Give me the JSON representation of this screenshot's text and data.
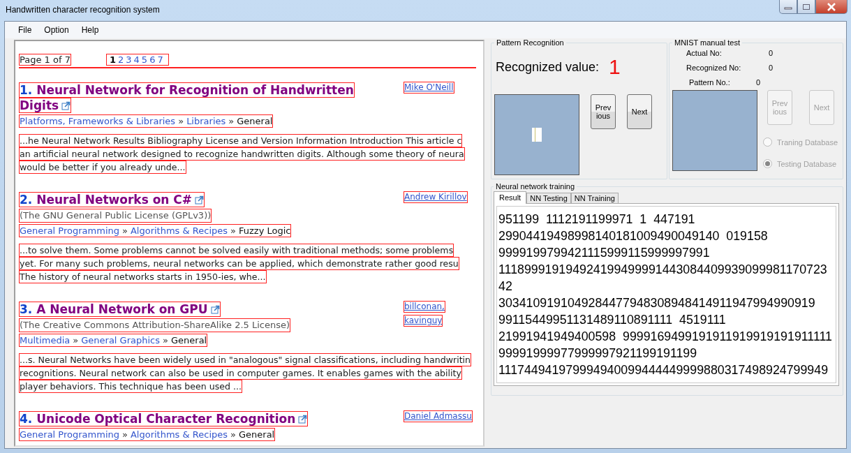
{
  "window": {
    "title": "Handwritten character recognition system"
  },
  "menu": [
    "File",
    "Option",
    "Help"
  ],
  "browser": {
    "page_label": "Page 1 of 7",
    "pages": [
      {
        "label": "1",
        "selected": true
      },
      {
        "label": "2",
        "selected": false
      },
      {
        "label": "3",
        "selected": false
      },
      {
        "label": "4",
        "selected": false
      },
      {
        "label": "5",
        "selected": false
      },
      {
        "label": "6",
        "selected": false
      },
      {
        "label": "7",
        "selected": false
      }
    ],
    "articles": [
      {
        "number": "1.",
        "title_lines": [
          "Neural Network for Recognition of Handwritten",
          "Digits"
        ],
        "authors": [
          "Mike O'Neill"
        ],
        "breadcrumb": {
          "links": [
            "Platforms, Frameworks & Libraries",
            "Libraries"
          ],
          "separator": "»",
          "current": "General"
        },
        "excerpt": [
          "...he Neural Network Results Bibliography License and Version Information Introduction This article c",
          "an artificial neural network designed to recognize handwritten digits. Although some theory of neura",
          "would be better if you already unde..."
        ]
      },
      {
        "number": "2.",
        "title_lines": [
          "Neural Networks on C#"
        ],
        "authors": [
          "Andrew Kirillov"
        ],
        "license": "(The GNU General Public License (GPLv3))",
        "breadcrumb": {
          "links": [
            "General Programming",
            "Algorithms & Recipes"
          ],
          "separator": "»",
          "current": "Fuzzy Logic"
        },
        "excerpt": [
          "...to solve them. Some problems cannot be solved easily with traditional methods; some problems",
          "yet. For many such problems, neural networks can be applied, which demonstrate rather good resu",
          "The history of neural networks starts in 1950-ies, whe..."
        ]
      },
      {
        "number": "3.",
        "title_lines": [
          "A Neural Network on GPU"
        ],
        "authors": [
          "billconan,",
          "kavinguy"
        ],
        "license": "(The Creative Commons Attribution-ShareAlike 2.5 License)",
        "breadcrumb": {
          "links": [
            "Multimedia",
            "General Graphics"
          ],
          "separator": "»",
          "current": "General"
        },
        "excerpt": [
          "...s. Neural Networks have been widely used in \"analogous\" signal classifications, including handwritin",
          "recognitions. Neural network can also be used in computer games. It enables games with the ability",
          "player behaviors. This technique has been used ..."
        ]
      },
      {
        "number": "4.",
        "title_lines": [
          "Unicode Optical Character Recognition"
        ],
        "authors": [
          "Daniel Admassu"
        ],
        "breadcrumb": {
          "links": [
            "General Programming",
            "Algorithms & Recipes"
          ],
          "separator": "»",
          "current": "General"
        }
      }
    ]
  },
  "pattern_recognition": {
    "title": "Pattern Recognition",
    "label": "Recognized value:",
    "value": "1",
    "buttons": [
      {
        "lines": [
          "Prev",
          "ious"
        ],
        "disabled": false
      },
      {
        "lines": [
          "Next"
        ],
        "disabled": false
      }
    ]
  },
  "mnist": {
    "title": "MNIST manual test",
    "fields": [
      {
        "label": "Actual No:",
        "value": "0"
      },
      {
        "label": "Recognized No:",
        "value": "0"
      }
    ],
    "pattern": {
      "label": "Pattern No.:",
      "value": "0"
    },
    "buttons": [
      {
        "lines": [
          "Prev",
          "ious"
        ],
        "disabled": true
      },
      {
        "lines": [
          "Next"
        ],
        "disabled": true
      }
    ],
    "radios": [
      {
        "label": "Traning Database",
        "selected": false,
        "disabled": true
      },
      {
        "label": "Testing Database",
        "selected": true,
        "disabled": true
      }
    ]
  },
  "training": {
    "title": "Neural network training",
    "tabs": [
      {
        "label": "Result",
        "selected": true
      },
      {
        "label": "NN Testing",
        "selected": false
      },
      {
        "label": "NN Training",
        "selected": false
      }
    ],
    "result_lines": [
      "951199  1112191199971  1  447191",
      "29904419498998140181009490049140  019158",
      "9999199799421115999115999997991",
      "111899919194924199499991443084409939099981170723",
      "42",
      "3034109191049284477948308948414911947994990919",
      "99115449951131489110891111  4519111",
      "21991941949400598  9999169499191911919919191911111",
      "99991999977999997921199191199",
      "111744941979994940099444449999880317498924799949"
    ]
  }
}
